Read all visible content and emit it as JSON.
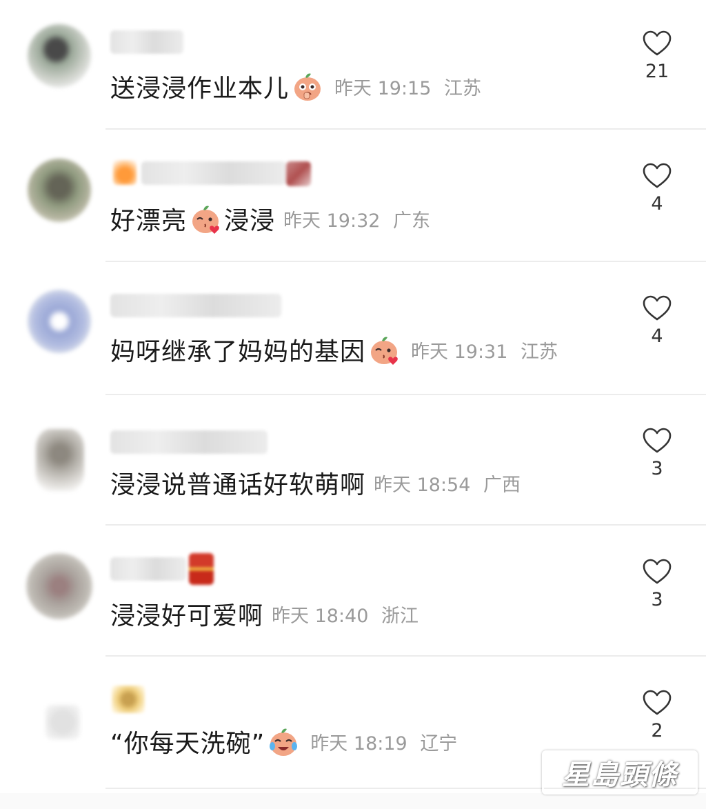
{
  "comments": [
    {
      "text": "送浸浸作业本儿",
      "emoji": "emoji-shy-icon",
      "time": "昨天 19:15",
      "location": "江苏",
      "likes": "21"
    },
    {
      "text_before": "好漂亮",
      "emoji": "emoji-kiss-icon",
      "text_after": "浸浸",
      "time": "昨天 19:32",
      "location": "广东",
      "likes": "4"
    },
    {
      "text": "妈呀继承了妈妈的基因",
      "emoji": "emoji-kiss-icon",
      "time": "昨天 19:31",
      "location": "江苏",
      "likes": "4"
    },
    {
      "text": "浸浸说普通话好软萌啊",
      "time": "昨天 18:54",
      "location": "广西",
      "likes": "3"
    },
    {
      "text": "浸浸好可爱啊",
      "time": "昨天 18:40",
      "location": "浙江",
      "likes": "3"
    },
    {
      "text": "“你每天洗碗”",
      "emoji": "emoji-laugh-cry-icon",
      "time": "昨天 18:19",
      "location": "辽宁",
      "likes": "2"
    }
  ],
  "watermark": "星島頭條",
  "colors": {
    "text": "#1a1a1a",
    "meta": "#9a9a9a",
    "divider": "#ececec",
    "heart_outline": "#333333"
  }
}
